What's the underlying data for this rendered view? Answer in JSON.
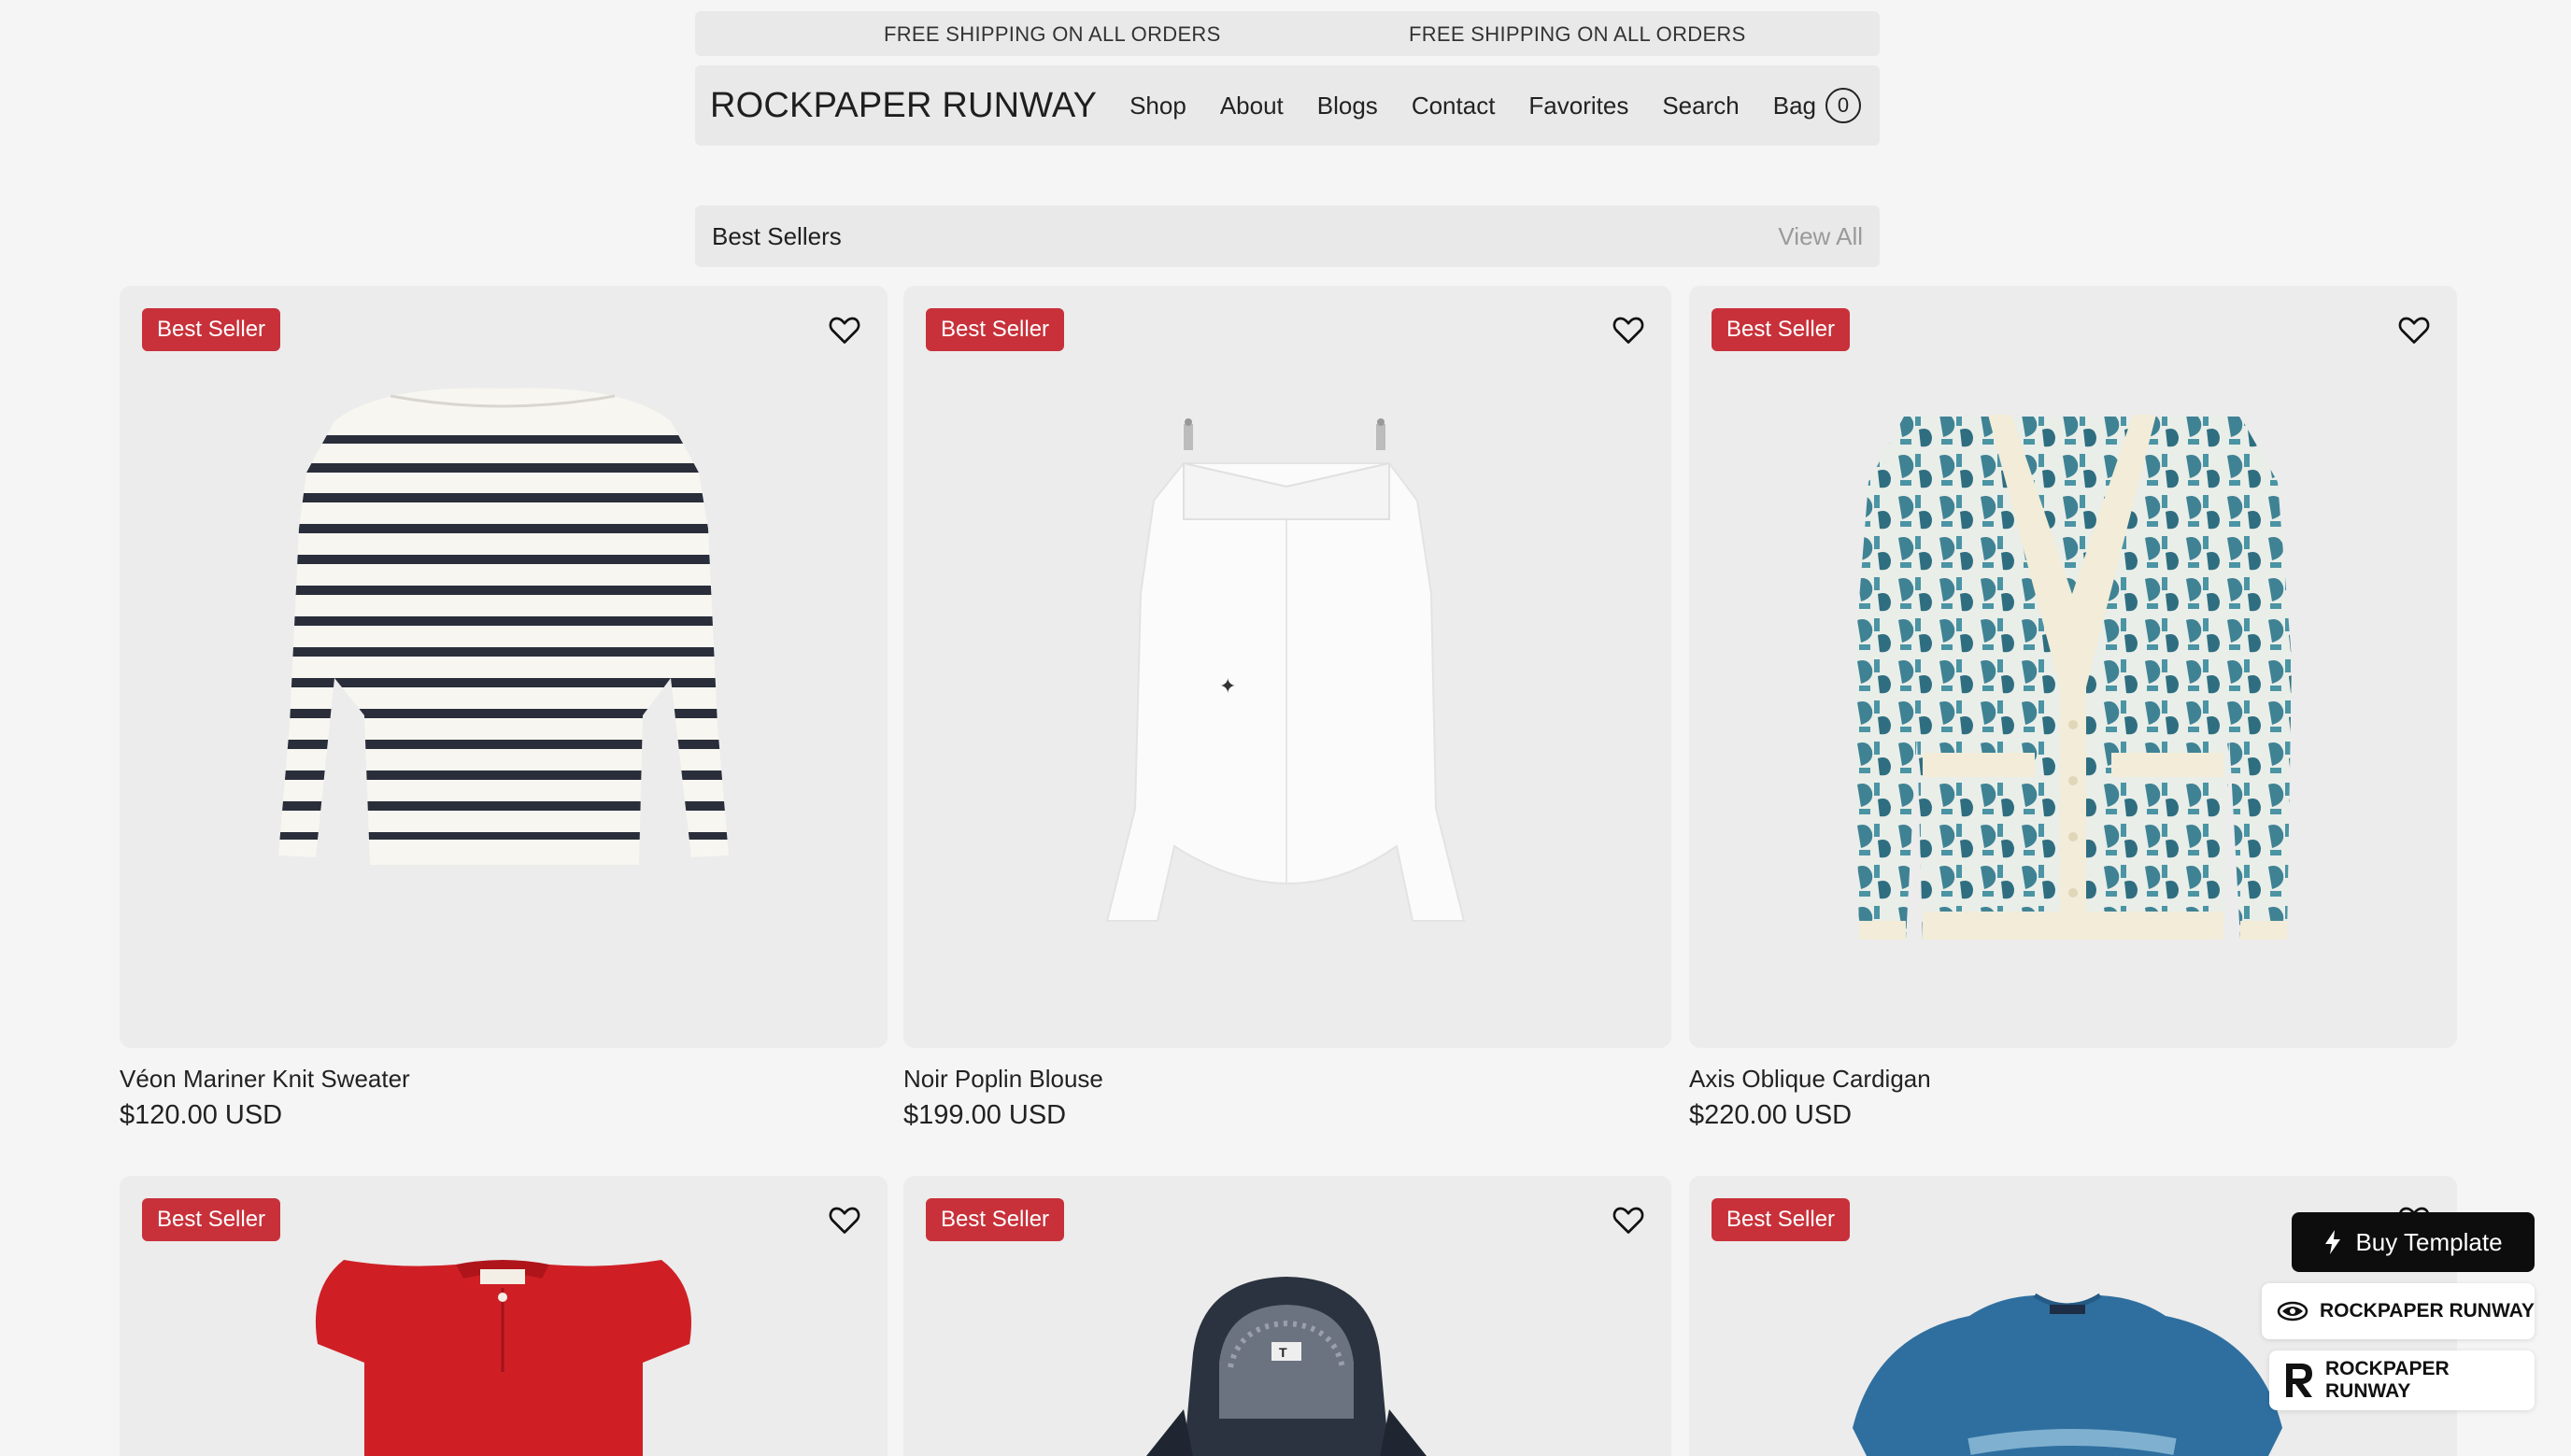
{
  "promo": {
    "left_text": "FREE SHIPPING ON ALL ORDERS",
    "right_text": "FREE SHIPPING ON ALL ORDERS"
  },
  "header": {
    "logo": "ROCKPAPER RUNWAY",
    "nav": [
      "Shop",
      "About",
      "Blogs",
      "Contact",
      "Favorites",
      "Search",
      "Bag"
    ],
    "bag_count": "0"
  },
  "section": {
    "title": "Best Sellers",
    "view_all": "View All"
  },
  "products": [
    {
      "badge": "Best Seller",
      "name": "Véon Mariner Knit Sweater",
      "price": "$120.00 USD",
      "image_icon": "striped-sweater-icon"
    },
    {
      "badge": "Best Seller",
      "name": "Noir Poplin Blouse",
      "price": "$199.00 USD",
      "image_icon": "white-blouse-icon"
    },
    {
      "badge": "Best Seller",
      "name": "Axis Oblique Cardigan",
      "price": "$220.00 USD",
      "image_icon": "patterned-cardigan-icon"
    },
    {
      "badge": "Best Seller",
      "image_icon": "red-top-icon"
    },
    {
      "badge": "Best Seller",
      "image_icon": "denim-hoodie-icon"
    },
    {
      "badge": "Best Seller",
      "image_icon": "blue-tshirt-icon"
    }
  ],
  "floating": {
    "buy_label": "Buy Template",
    "brand_label_1": "ROCKPAPER RUNWAY",
    "brand_label_2": "ROCKPAPER RUNWAY"
  },
  "colors": {
    "badge": "#c8313a",
    "accent_dark": "#0d0d0d",
    "background": "#f5f5f5",
    "panel": "#e9e9e9"
  }
}
